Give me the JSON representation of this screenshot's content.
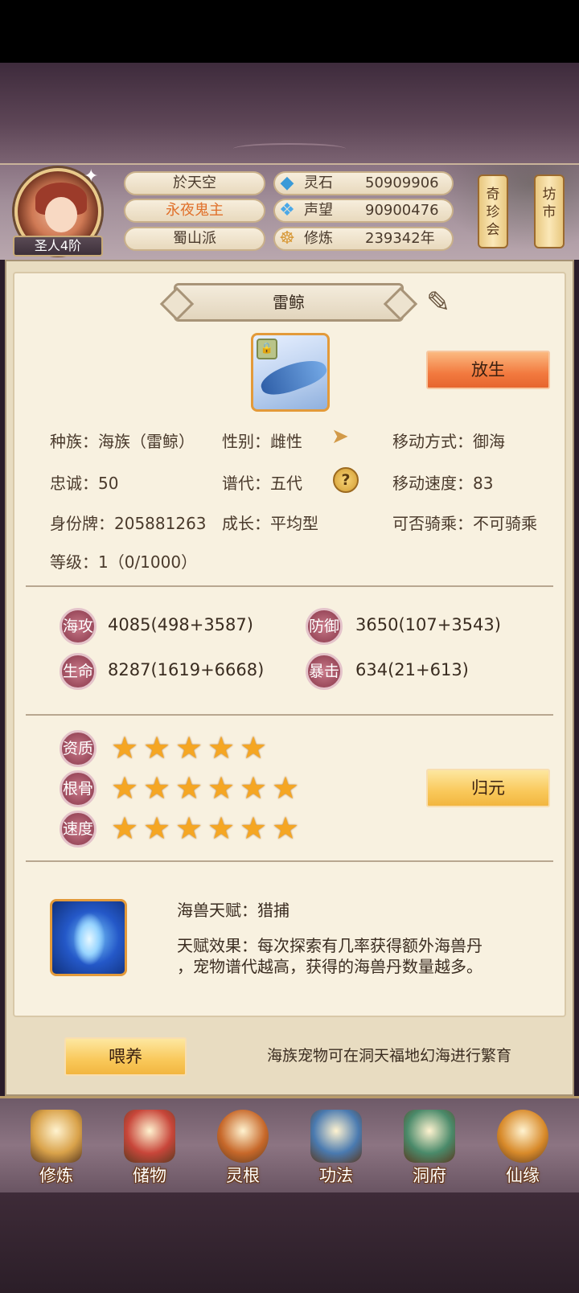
{
  "header": {
    "rank": "圣人4阶",
    "player_name": "於天空",
    "title": "永夜鬼主",
    "sect": "蜀山派",
    "resources": [
      {
        "icon": "crystal-icon",
        "label": "灵石",
        "value": "50909906"
      },
      {
        "icon": "reputation-icon",
        "label": "声望",
        "value": "90900476"
      },
      {
        "icon": "meditation-icon",
        "label": "修炼",
        "value": "239342年"
      }
    ],
    "shop_buttons": [
      {
        "chars": [
          "奇",
          "珍",
          "会"
        ]
      },
      {
        "chars": [
          "坊",
          "市"
        ]
      }
    ]
  },
  "pet": {
    "name": "雷鲸",
    "release_button": "放生",
    "info": {
      "race": "种族：海族（雷鲸）",
      "gender": "性别：雌性",
      "move_type": "移动方式：御海",
      "loyalty": "忠诚：50",
      "generation": "谱代：五代",
      "move_speed": "移动速度：83",
      "id_tag": "身份牌：205881263",
      "growth": "成长：平均型",
      "rideable": "可否骑乘：不可骑乘",
      "level": "等级：1（0/1000）"
    },
    "stats": [
      {
        "label": "海攻",
        "value": "4085(498+3587)"
      },
      {
        "label": "防御",
        "value": "3650(107+3543)"
      },
      {
        "label": "生命",
        "value": "8287(1619+6668)"
      },
      {
        "label": "暴击",
        "value": "634(21+613)"
      }
    ],
    "ratings": [
      {
        "label": "资质",
        "stars": 5
      },
      {
        "label": "根骨",
        "stars": 6
      },
      {
        "label": "速度",
        "stars": 6
      }
    ],
    "reset_button": "归元",
    "talent_name": "海兽天赋：猎捕",
    "talent_effect_1": "天赋效果：每次探索有几率获得额外海兽丹",
    "talent_effect_2": "，宠物谱代越高，获得的海兽丹数量越多。",
    "feed_button": "喂养",
    "note": "海族宠物可在洞天福地幻海进行繁育"
  },
  "nav": [
    {
      "label": "修炼",
      "icon": "cultivation-icon",
      "color": "#d9a24a"
    },
    {
      "label": "储物",
      "icon": "storage-bag-icon",
      "color": "#c8463a"
    },
    {
      "label": "灵根",
      "icon": "spirit-root-icon",
      "color": "#c7682a"
    },
    {
      "label": "功法",
      "icon": "technique-book-icon",
      "color": "#4a7ab0"
    },
    {
      "label": "洞府",
      "icon": "cave-palace-icon",
      "color": "#4a8a6a"
    },
    {
      "label": "仙缘",
      "icon": "gourd-icon",
      "color": "#d88a2a"
    }
  ]
}
